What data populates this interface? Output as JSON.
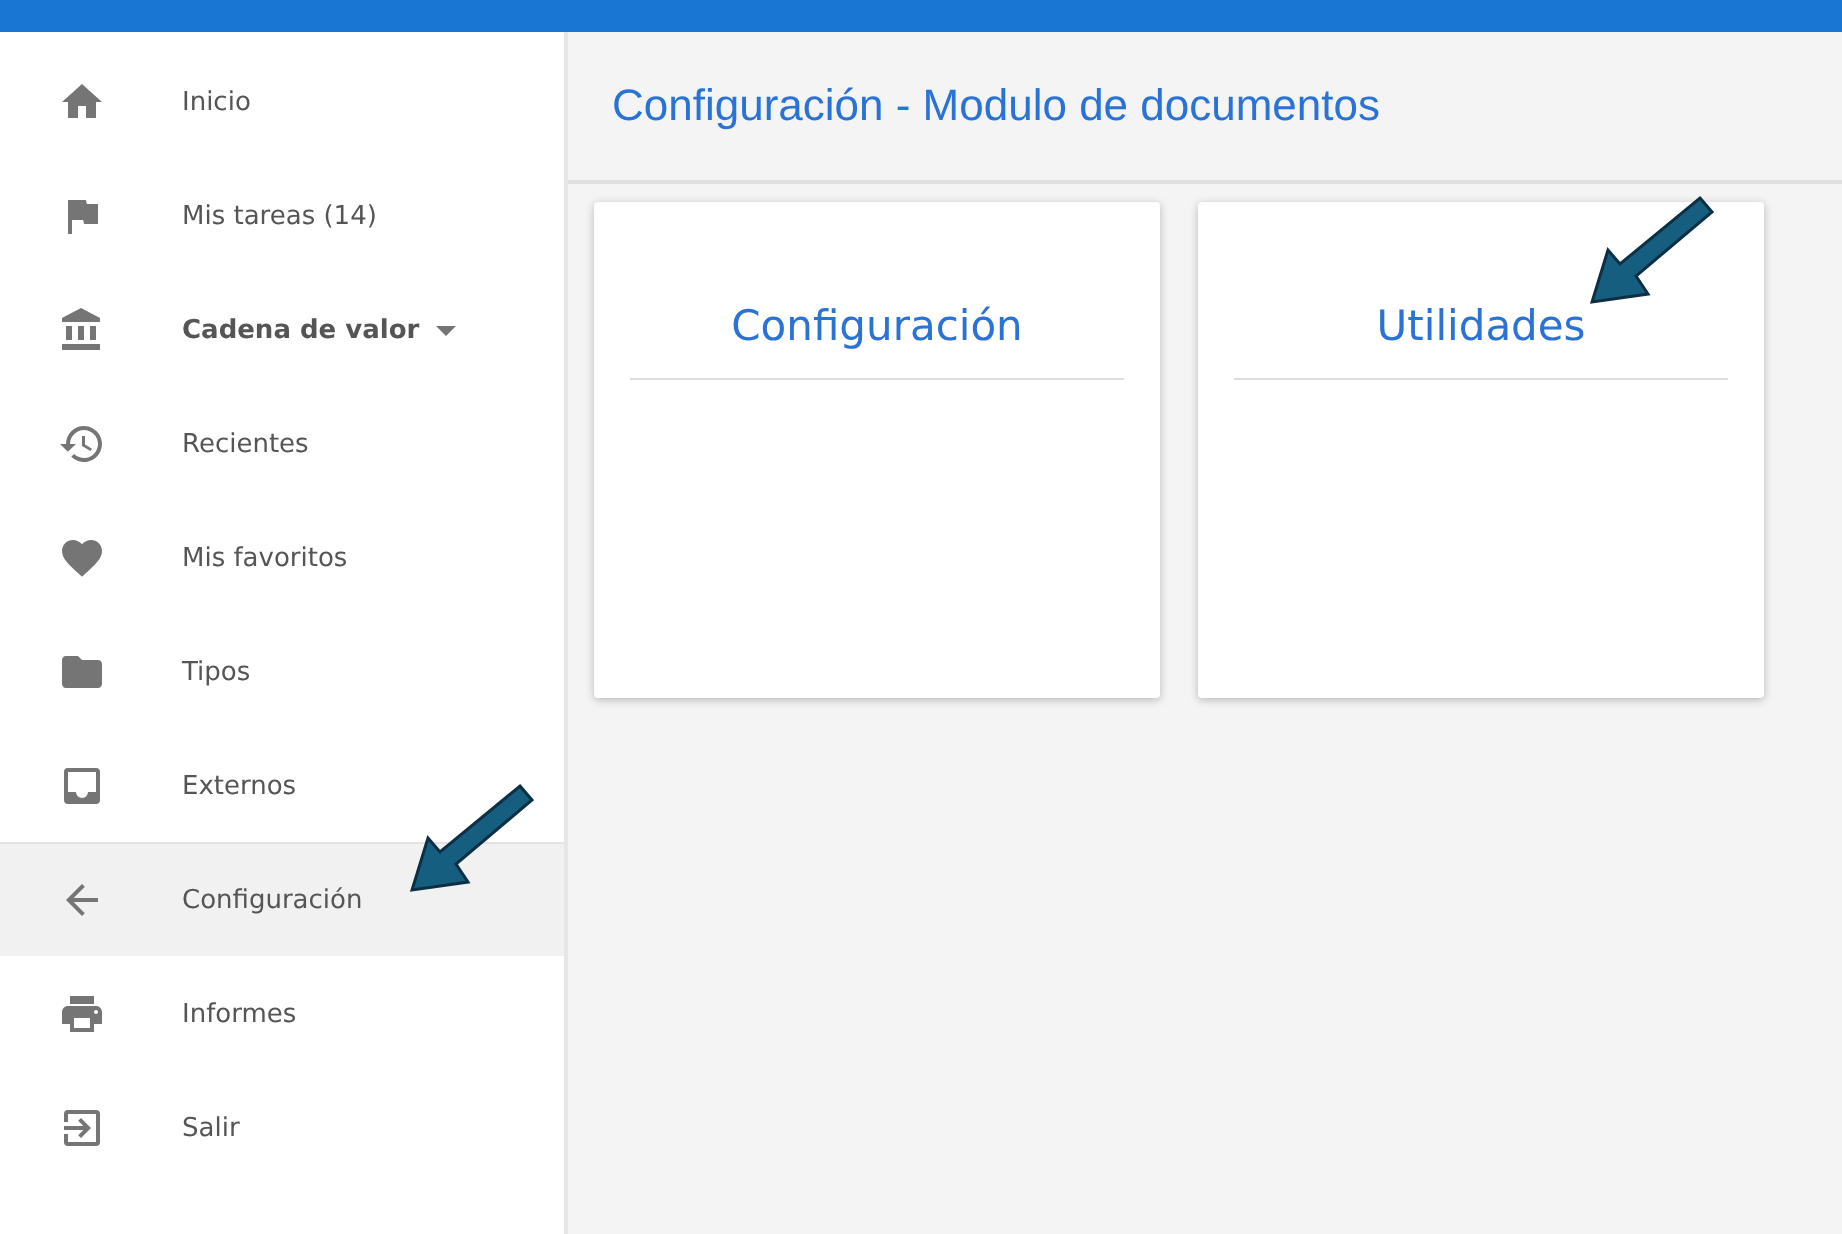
{
  "sidebar": {
    "items": [
      {
        "label": "Inicio",
        "kind": "link",
        "selected": false,
        "pointed": false
      },
      {
        "label": "Mis tareas (14)",
        "kind": "link",
        "selected": false,
        "pointed": false
      },
      {
        "label": "Cadena de valor",
        "kind": "dropdown",
        "selected": false,
        "pointed": false
      },
      {
        "label": "Recientes",
        "kind": "link",
        "selected": false,
        "pointed": false
      },
      {
        "label": "Mis favoritos",
        "kind": "link",
        "selected": false,
        "pointed": false
      },
      {
        "label": "Tipos",
        "kind": "link",
        "selected": false,
        "pointed": false
      },
      {
        "label": "Externos",
        "kind": "link",
        "selected": false,
        "pointed": false
      },
      {
        "label": "Configuración",
        "kind": "link",
        "selected": true,
        "pointed": true
      },
      {
        "label": "Informes",
        "kind": "link",
        "selected": false,
        "pointed": false
      },
      {
        "label": "Salir",
        "kind": "link",
        "selected": false,
        "pointed": false
      }
    ]
  },
  "page": {
    "title": "Configuración - Modulo de documentos"
  },
  "cards": [
    {
      "title": "Configuración",
      "pointed": false
    },
    {
      "title": "Utilidades",
      "pointed": true
    }
  ]
}
